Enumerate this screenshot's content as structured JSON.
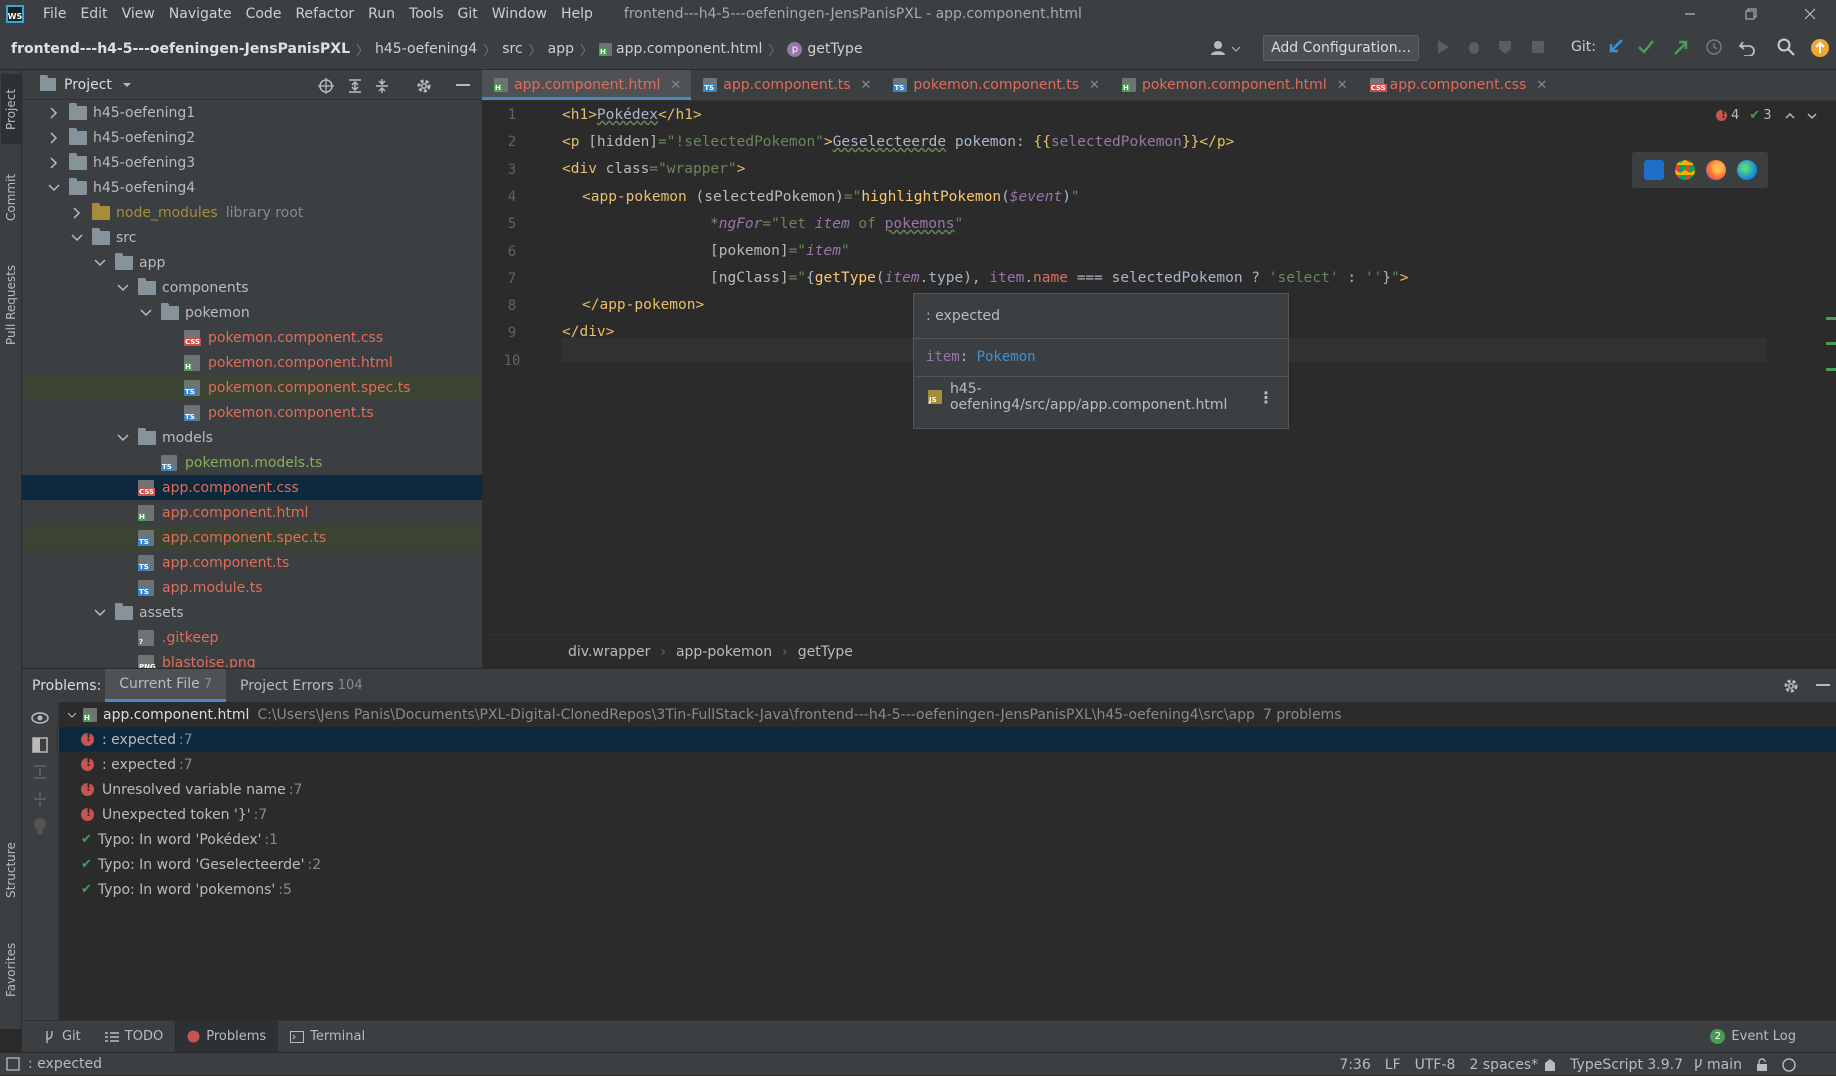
{
  "menubar": {
    "items": [
      "File",
      "Edit",
      "View",
      "Navigate",
      "Code",
      "Refactor",
      "Run",
      "Tools",
      "Git",
      "Window",
      "Help"
    ],
    "window_title": "frontend---h4-5---oefeningen-JensPanisPXL - app.component.html"
  },
  "navbar": {
    "crumbs": [
      "frontend---h4-5---oefeningen-JensPanisPXL",
      "h45-oefening4",
      "src",
      "app",
      "app.component.html",
      "getType"
    ],
    "add_configuration": "Add Configuration...",
    "git_label": "Git:"
  },
  "left_strip": {
    "project": "Project",
    "commit": "Commit",
    "pull_requests": "Pull Requests",
    "structure": "Structure",
    "favorites": "Favorites"
  },
  "project": {
    "title": "Project",
    "tree": [
      {
        "label": "h45-oefening1",
        "type": "folder",
        "indent": 1,
        "arrow": "right",
        "color": "default"
      },
      {
        "label": "h45-oefening2",
        "type": "folder",
        "indent": 1,
        "arrow": "right",
        "color": "default"
      },
      {
        "label": "h45-oefening3",
        "type": "folder",
        "indent": 1,
        "arrow": "right",
        "color": "default"
      },
      {
        "label": "h45-oefening4",
        "type": "folder",
        "indent": 1,
        "arrow": "down",
        "color": "default"
      },
      {
        "label": "node_modules",
        "suffix": "library root",
        "type": "folder-excluded",
        "indent": 2,
        "arrow": "right",
        "color": "olive"
      },
      {
        "label": "src",
        "type": "folder",
        "indent": 2,
        "arrow": "down",
        "color": "default"
      },
      {
        "label": "app",
        "type": "folder",
        "indent": 3,
        "arrow": "down",
        "color": "default"
      },
      {
        "label": "components",
        "type": "folder",
        "indent": 4,
        "arrow": "down",
        "color": "default"
      },
      {
        "label": "pokemon",
        "type": "folder",
        "indent": 5,
        "arrow": "down",
        "color": "default"
      },
      {
        "label": "pokemon.component.css",
        "type": "css",
        "indent": 6,
        "color": "red"
      },
      {
        "label": "pokemon.component.html",
        "type": "html",
        "indent": 6,
        "color": "red"
      },
      {
        "label": "pokemon.component.spec.ts",
        "type": "ts",
        "indent": 6,
        "color": "red",
        "highlight": true
      },
      {
        "label": "pokemon.component.ts",
        "type": "ts",
        "indent": 6,
        "color": "red"
      },
      {
        "label": "models",
        "type": "folder",
        "indent": 4,
        "arrow": "down",
        "color": "default"
      },
      {
        "label": "pokemon.models.ts",
        "type": "ts",
        "indent": 5,
        "color": "green"
      },
      {
        "label": "app.component.css",
        "type": "css",
        "indent": 4,
        "color": "red",
        "selected": true
      },
      {
        "label": "app.component.html",
        "type": "html",
        "indent": 4,
        "color": "red"
      },
      {
        "label": "app.component.spec.ts",
        "type": "ts",
        "indent": 4,
        "color": "red",
        "highlight": true
      },
      {
        "label": "app.component.ts",
        "type": "ts",
        "indent": 4,
        "color": "red"
      },
      {
        "label": "app.module.ts",
        "type": "ts",
        "indent": 4,
        "color": "red"
      },
      {
        "label": "assets",
        "type": "folder",
        "indent": 3,
        "arrow": "down",
        "color": "default"
      },
      {
        "label": ".gitkeep",
        "type": "unknown",
        "indent": 4,
        "color": "red"
      },
      {
        "label": "blastoise.png",
        "type": "png",
        "indent": 4,
        "color": "red"
      }
    ]
  },
  "editor": {
    "tabs": [
      {
        "label": "app.component.html",
        "type": "html",
        "active": true
      },
      {
        "label": "app.component.ts",
        "type": "ts"
      },
      {
        "label": "pokemon.component.ts",
        "type": "ts"
      },
      {
        "label": "pokemon.component.html",
        "type": "html"
      },
      {
        "label": "app.component.css",
        "type": "css"
      }
    ],
    "line_numbers": [
      "1",
      "2",
      "3",
      "4",
      "5",
      "6",
      "7",
      "8",
      "9",
      "10"
    ],
    "error_count": "4",
    "warning_count": "3",
    "breadcrumbs": [
      "div.wrapper",
      "app-pokemon",
      "getType"
    ],
    "popup": {
      "message": ": expected",
      "var_name": "item",
      "var_type": "Pokemon",
      "location": "h45-oefening4/src/app/app.component.html"
    }
  },
  "problems": {
    "label": "Problems:",
    "tabs": [
      {
        "label": "Current File",
        "count": "7",
        "active": true
      },
      {
        "label": "Project Errors",
        "count": "104"
      }
    ],
    "file": "app.component.html",
    "path": "C:\\Users\\Jens Panis\\Documents\\PXL-Digital-ClonedRepos\\3Tin-FullStack-Java\\frontend---h4-5---oefeningen-JensPanisPXL\\h45-oefening4\\src\\app",
    "file_count": "7 problems",
    "items": [
      {
        "kind": "error",
        "text": ": expected",
        "line": ":7",
        "selected": true
      },
      {
        "kind": "error",
        "text": ": expected",
        "line": ":7"
      },
      {
        "kind": "error",
        "text": "Unresolved variable name",
        "line": ":7"
      },
      {
        "kind": "error",
        "text": "Unexpected token '}'",
        "line": ":7"
      },
      {
        "kind": "typo",
        "text": "Typo: In word 'Pokédex'",
        "line": ":1"
      },
      {
        "kind": "typo",
        "text": "Typo: In word 'Geselecteerde'",
        "line": ":2"
      },
      {
        "kind": "typo",
        "text": "Typo: In word 'pokemons'",
        "line": ":5"
      }
    ]
  },
  "bottom_toolbar": [
    {
      "label": "Git",
      "icon": "git-icon"
    },
    {
      "label": "TODO",
      "icon": "todo-icon"
    },
    {
      "label": "Problems",
      "icon": "error-icon",
      "active": true
    },
    {
      "label": "Terminal",
      "icon": "terminal-icon"
    }
  ],
  "event_log": {
    "label": "Event Log",
    "count": "2"
  },
  "statusbar": {
    "message": ": expected",
    "position": "7:36",
    "line_sep": "LF",
    "encoding": "UTF-8",
    "indent": "2 spaces*",
    "language": "TypeScript 3.9.7",
    "branch": "main"
  }
}
